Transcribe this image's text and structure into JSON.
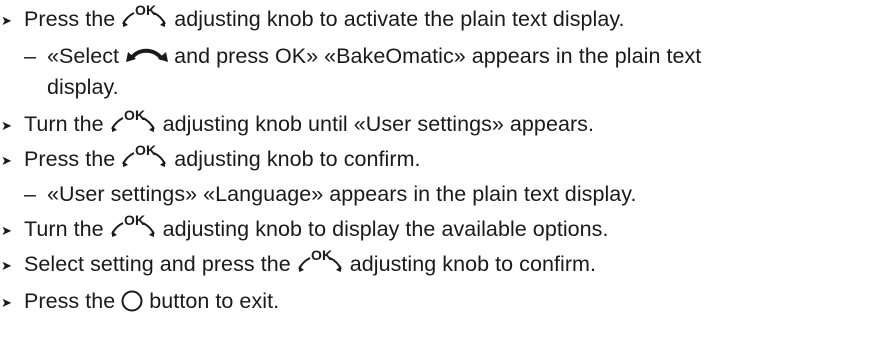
{
  "bullet_glyph": "➤",
  "dash_glyph": "–",
  "knob_label": "OK",
  "steps": [
    {
      "before": "Press the",
      "after": "adjusting knob to activate the plain text display."
    },
    {
      "before": "«Select",
      "after": "and press OK» «BakeOmatic» appears in the plain text",
      "continuation": "display."
    },
    {
      "before": "Turn the",
      "after": "adjusting knob until «User settings» appears."
    },
    {
      "before": "Press the",
      "after": "adjusting knob to confirm."
    },
    {
      "text": "«User settings» «Language» appears in the plain text display."
    },
    {
      "before": "Turn the",
      "after": "adjusting knob to display the available options."
    },
    {
      "before": "Select setting and press the",
      "after": "adjusting knob to confirm."
    },
    {
      "before": "Press the",
      "after": "button to exit."
    }
  ],
  "icons": {
    "knob": "ok-adjusting-knob-icon",
    "select_curve": "curved-double-arrow-icon",
    "button": "circle-button-icon"
  },
  "colors": {
    "text": "#1a1a1a",
    "background": "#ffffff"
  }
}
